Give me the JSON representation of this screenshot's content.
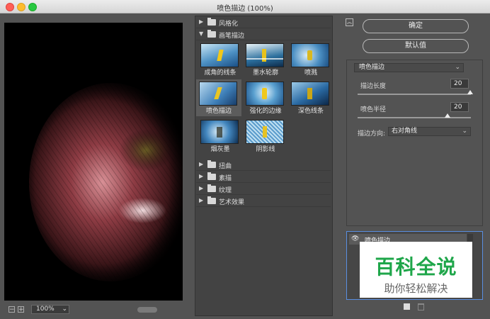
{
  "window": {
    "title": "喷色描边 (100%)"
  },
  "preview": {
    "zoom": "100%",
    "zoom_out_icon": "−",
    "zoom_in_icon": "+"
  },
  "gallery": {
    "categories_top": [
      {
        "label": "风格化",
        "expanded": false
      },
      {
        "label": "画笔描边",
        "expanded": true
      }
    ],
    "thumbnails": [
      {
        "label": "成角的线条",
        "selected": false
      },
      {
        "label": "墨水轮廓",
        "selected": false
      },
      {
        "label": "喷溅",
        "selected": false
      },
      {
        "label": "喷色描边",
        "selected": true
      },
      {
        "label": "强化的边缘",
        "selected": false
      },
      {
        "label": "深色线条",
        "selected": false
      },
      {
        "label": "烟灰墨",
        "selected": false
      },
      {
        "label": "阴影线",
        "selected": false
      }
    ],
    "categories_bottom": [
      {
        "label": "扭曲",
        "expanded": false
      },
      {
        "label": "素描",
        "expanded": false
      },
      {
        "label": "纹理",
        "expanded": false
      },
      {
        "label": "艺术效果",
        "expanded": false
      }
    ]
  },
  "buttons": {
    "ok": "确定",
    "default": "默认值",
    "collapse_icon": "chevron-up-icon"
  },
  "settings": {
    "filter": "喷色描边",
    "stroke_length_label": "描边长度",
    "stroke_length": "20",
    "stroke_length_fraction": 1.0,
    "spray_radius_label": "喷色半径",
    "spray_radius": "20",
    "spray_radius_fraction": 0.8,
    "direction_label": "描边方向:",
    "direction": "右对角线"
  },
  "layers": {
    "item": "喷色描边"
  },
  "watermark": {
    "title": "百科全说",
    "subtitle": "助你轻松解决"
  },
  "colors": {
    "background": "#535353",
    "panel": "#434343",
    "selection": "#5a8ee0",
    "watermark_green": "#1fa64a"
  }
}
